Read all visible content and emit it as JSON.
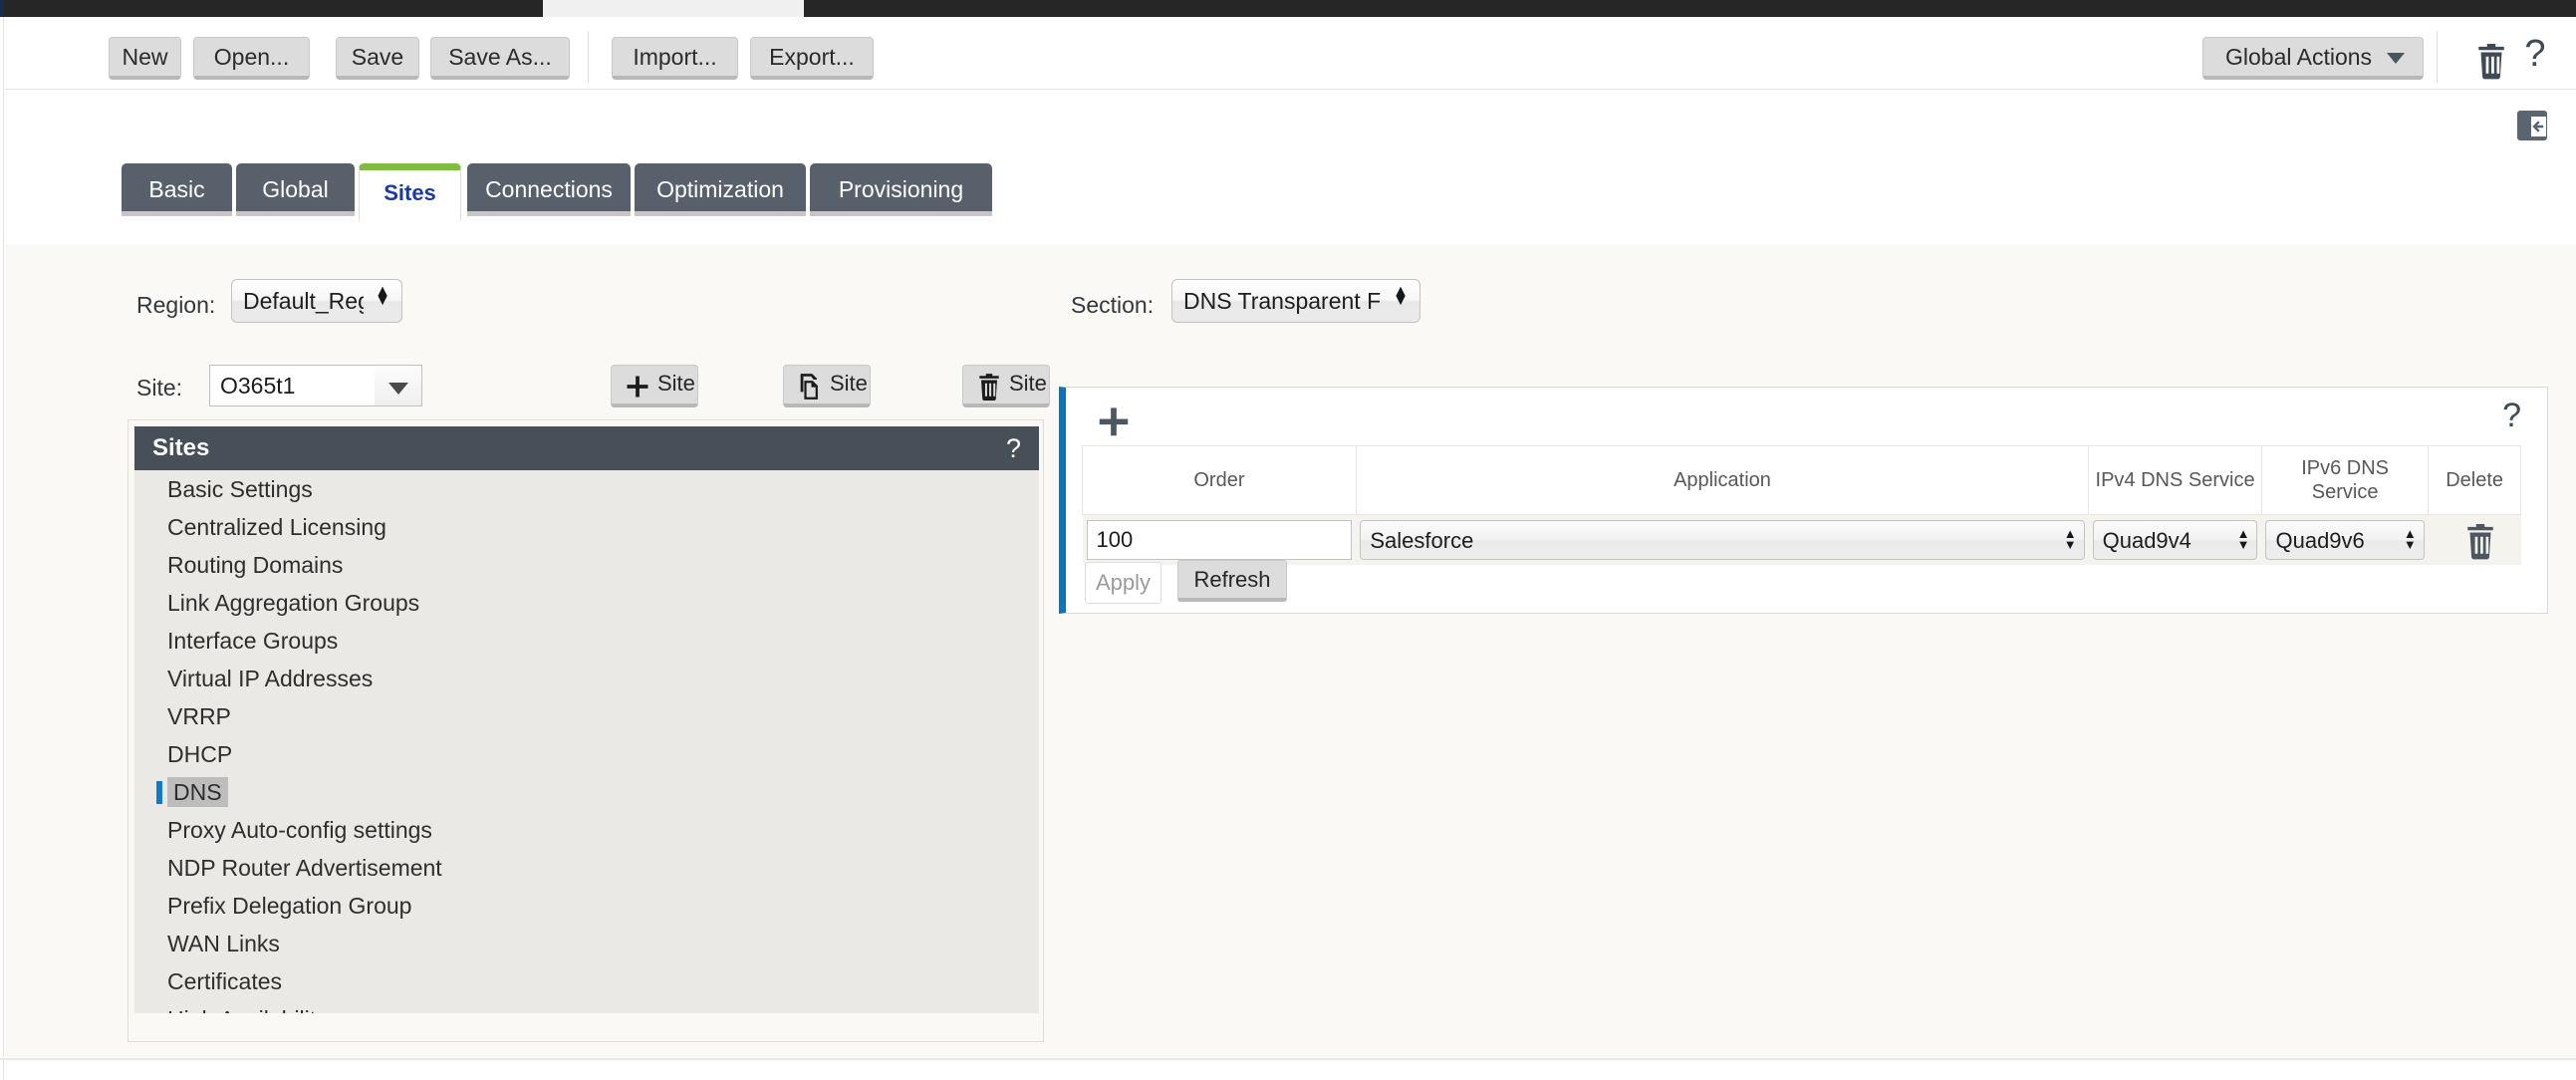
{
  "toolbar": {
    "buttons": [
      {
        "id": "new",
        "label": "New"
      },
      {
        "id": "open",
        "label": "Open..."
      },
      {
        "id": "save",
        "label": "Save"
      },
      {
        "id": "saveas",
        "label": "Save As..."
      },
      {
        "id": "import",
        "label": "Import..."
      },
      {
        "id": "export",
        "label": "Export..."
      }
    ],
    "global_actions_label": "Global Actions",
    "trash_icon": "trash-icon",
    "help_icon": "question-mark-icon",
    "collapse_icon": "collapse-panel-icon"
  },
  "tabs": [
    {
      "label": "Basic",
      "active": false
    },
    {
      "label": "Global",
      "active": false
    },
    {
      "label": "Sites",
      "active": true
    },
    {
      "label": "Connections",
      "active": false
    },
    {
      "label": "Optimization",
      "active": false
    },
    {
      "label": "Provisioning",
      "active": false
    }
  ],
  "left": {
    "region_label": "Region:",
    "region_value": "Default_Region",
    "site_label": "Site:",
    "site_value": "O365t1",
    "site_placeholder": "",
    "add_site_label": "Site",
    "copy_site_label": "Site",
    "delete_site_label": "Site",
    "add_site_icon": "plus-icon",
    "copy_site_icon": "copy-icon",
    "delete_site_icon": "trash-icon"
  },
  "sidebar": {
    "title": "Sites",
    "help_icon": "question-mark-icon",
    "items": [
      {
        "label": "Basic Settings",
        "selected": false
      },
      {
        "label": "Centralized Licensing",
        "selected": false
      },
      {
        "label": "Routing Domains",
        "selected": false
      },
      {
        "label": "Link Aggregation Groups",
        "selected": false
      },
      {
        "label": "Interface Groups",
        "selected": false
      },
      {
        "label": "Virtual IP Addresses",
        "selected": false
      },
      {
        "label": "VRRP",
        "selected": false
      },
      {
        "label": "DHCP",
        "selected": false
      },
      {
        "label": "DNS",
        "selected": true
      },
      {
        "label": "Proxy Auto-config settings",
        "selected": false
      },
      {
        "label": "NDP Router Advertisement",
        "selected": false
      },
      {
        "label": "Prefix Delegation Group",
        "selected": false
      },
      {
        "label": "WAN Links",
        "selected": false
      },
      {
        "label": "Certificates",
        "selected": false
      },
      {
        "label": "High Availability",
        "selected": false
      }
    ]
  },
  "right": {
    "section_label": "Section:",
    "section_value": "DNS Transparent Forwarders",
    "panel": {
      "add_icon": "plus-icon",
      "help_icon": "question-mark-icon",
      "columns": [
        "Order",
        "Application",
        "IPv4 DNS Service",
        "IPv6 DNS Service",
        "Delete"
      ],
      "rows": [
        {
          "order": "100",
          "application": "Salesforce",
          "ipv4_dns_service": "Quad9v4",
          "ipv6_dns_service": "Quad9v6",
          "delete_icon": "trash-icon"
        }
      ],
      "apply_label": "Apply",
      "apply_enabled": false,
      "refresh_label": "Refresh"
    }
  },
  "colors": {
    "accent_blue": "#0b75bc",
    "tab_active_top": "#7cbd42",
    "tab_inactive_bg": "#58616b",
    "sidebar_header_bg": "#474f59",
    "selected_item_bar": "#1479c4",
    "page_bg": "#faf9f5"
  }
}
